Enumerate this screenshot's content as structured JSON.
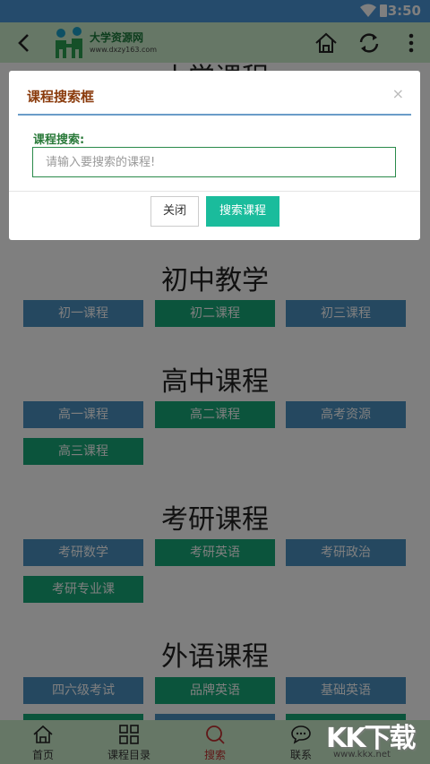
{
  "status_bar": {
    "time": "3:50"
  },
  "app_bar": {
    "logo_name": "大学资源网",
    "logo_domain": "www.dxzy163.com"
  },
  "sections": [
    {
      "title": "小学课程",
      "buttons": []
    },
    {
      "title": "初中教学",
      "buttons": [
        {
          "label": "初一课程",
          "color": "blue"
        },
        {
          "label": "初二课程",
          "color": "green"
        },
        {
          "label": "初三课程",
          "color": "blue"
        }
      ]
    },
    {
      "title": "高中课程",
      "buttons": [
        {
          "label": "高一课程",
          "color": "blue"
        },
        {
          "label": "高二课程",
          "color": "green"
        },
        {
          "label": "高考资源",
          "color": "blue"
        },
        {
          "label": "高三课程",
          "color": "green"
        }
      ]
    },
    {
      "title": "考研课程",
      "buttons": [
        {
          "label": "考研数学",
          "color": "blue"
        },
        {
          "label": "考研英语",
          "color": "green"
        },
        {
          "label": "考研政治",
          "color": "blue"
        },
        {
          "label": "考研专业课",
          "color": "green"
        }
      ]
    },
    {
      "title": "外语课程",
      "buttons": [
        {
          "label": "四六级考试",
          "color": "blue"
        },
        {
          "label": "品牌英语",
          "color": "green"
        },
        {
          "label": "基础英语",
          "color": "blue"
        }
      ]
    }
  ],
  "tab_bar": {
    "items": [
      {
        "label": "首页",
        "icon": "home-icon"
      },
      {
        "label": "课程目录",
        "icon": "grid-icon"
      },
      {
        "label": "搜索",
        "icon": "search-icon",
        "active": true
      },
      {
        "label": "联系",
        "icon": "chat-icon"
      }
    ]
  },
  "modal": {
    "title": "课程搜索框",
    "close_symbol": "×",
    "field_label": "课程搜索:",
    "search_value": "",
    "search_placeholder": "请输入要搜索的课程!",
    "close_button": "关闭",
    "search_button": "搜索课程"
  },
  "watermark": {
    "big": "KK下载",
    "small": "www.kkx.net"
  },
  "colors": {
    "accent_green": "#17a878",
    "accent_blue": "#4a90c0",
    "status_bar": "#4a97d8",
    "app_bar": "#cdeecd"
  }
}
